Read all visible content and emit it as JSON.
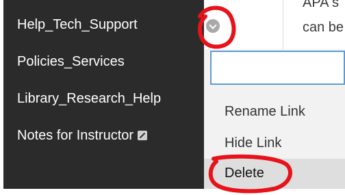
{
  "sidebar": {
    "items": [
      {
        "label": "Help_Tech_Support"
      },
      {
        "label": "Policies_Services"
      },
      {
        "label": "Library_Research_Help"
      },
      {
        "label": "Notes for Instructor",
        "icon": "hidden-from-students-icon"
      }
    ]
  },
  "content": {
    "lines": [
      "APA s",
      "can be"
    ]
  },
  "context_menu": {
    "items": [
      "Rename Link",
      "Hide Link",
      "Delete"
    ]
  },
  "colors": {
    "sidebar_bg": "#2b2b2b",
    "menu_bg": "#f2f2f2",
    "focus_border": "#5b9bd5",
    "annotation": "#e8131a"
  }
}
